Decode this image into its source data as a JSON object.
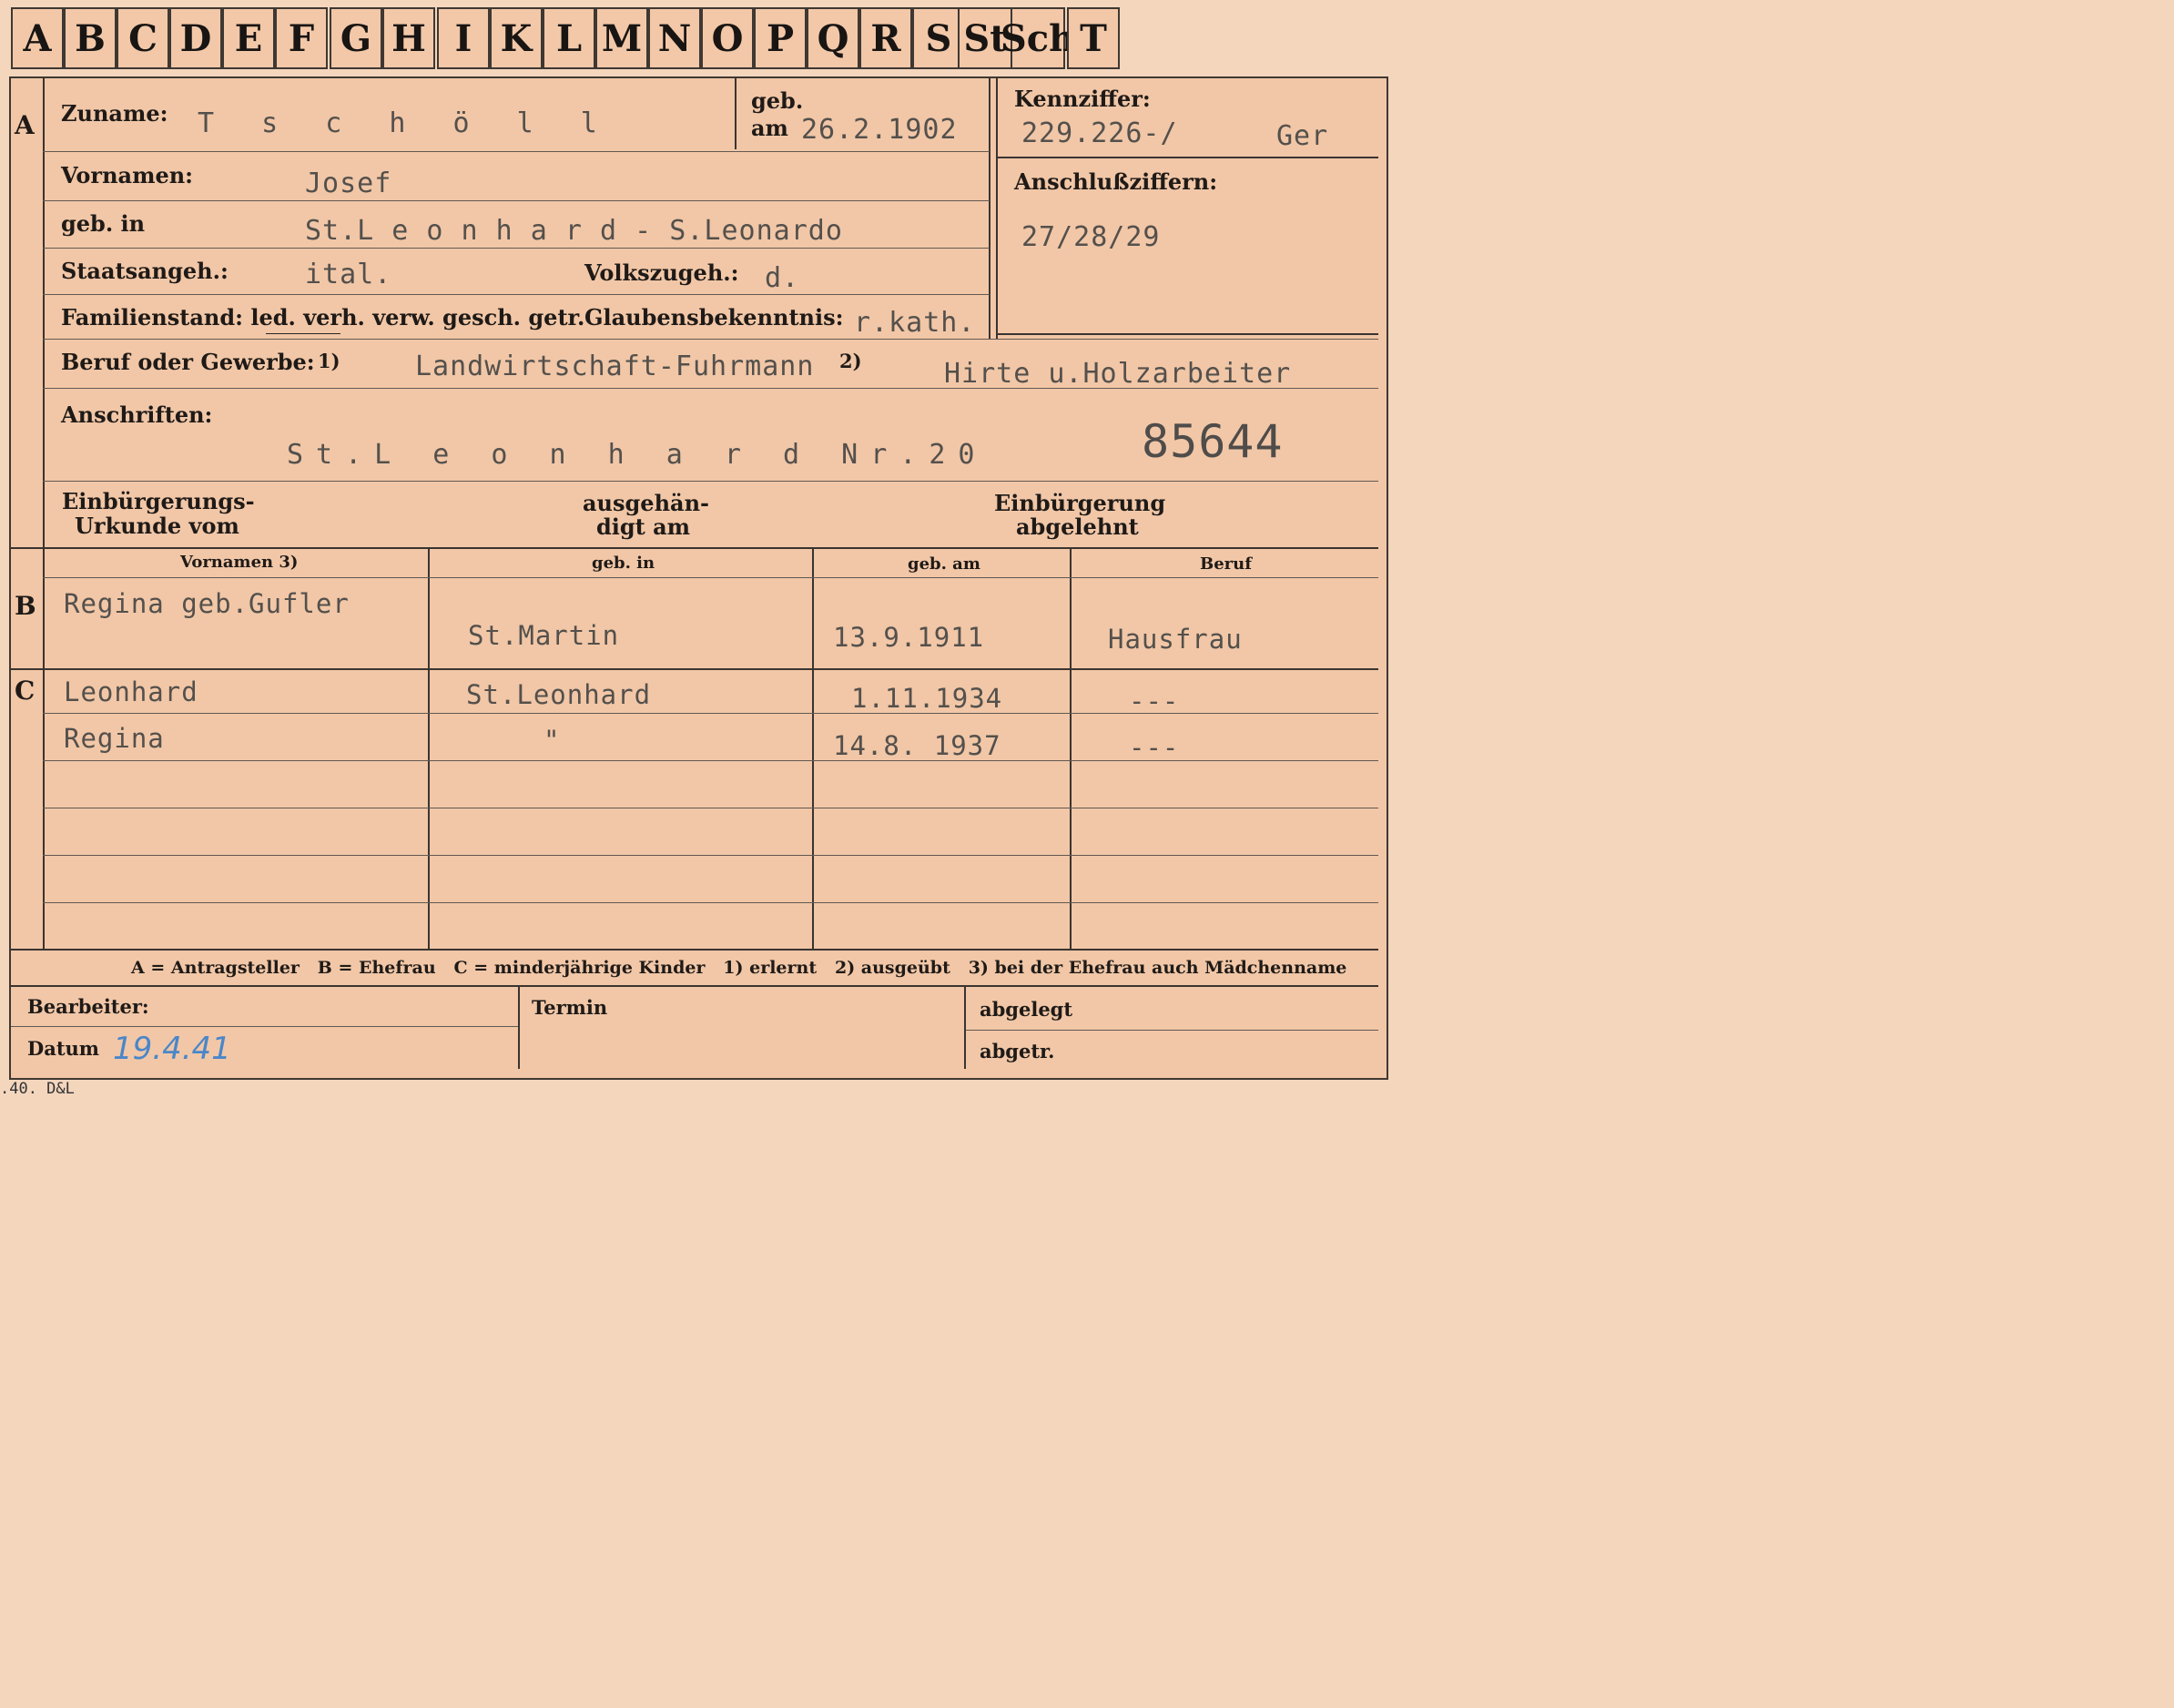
{
  "index_tabs": [
    "A",
    "B",
    "C",
    "D",
    "E",
    "F",
    "G",
    "H",
    "I",
    "K",
    "L",
    "M",
    "N",
    "O",
    "P",
    "Q",
    "R",
    "S",
    "St",
    "Sch",
    "T"
  ],
  "section_labels": {
    "a": "A",
    "b": "B",
    "c": "C"
  },
  "section_a": {
    "surname_label": "Zuname:",
    "surname_value": "T s c h ö l l",
    "born_label_1": "geb.",
    "born_label_2": "am",
    "born_value": "26.2.1902",
    "id_label": "Kennziffer:",
    "id_value": "229.226-/",
    "id_suffix": "Ger",
    "connect_label": "Anschlußziffern:",
    "connect_value": "27/28/29",
    "given_label": "Vornamen:",
    "given_value": "Josef",
    "birthplace_label": "geb. in",
    "birthplace_value": "St.L e o n h a r d  - S.Leonardo",
    "citizenship_label": "Staatsangeh.:",
    "citizenship_value": "ital.",
    "ethnicity_label": "Volkszugeh.:",
    "ethnicity_value": "d.",
    "marital_label": "Familienstand: led. verh. verw. gesch. getr.",
    "religion_label": "Glaubensbekenntnis:",
    "religion_value": "r.kath.",
    "profession_label": "Beruf oder Gewerbe:",
    "profession_note_1": "1)",
    "profession_value": "Landwirtschaft-Fuhrmann",
    "profession_note_2": "2)",
    "profession_value_2": "Hirte u.Holzarbeiter",
    "address_label": "Anschriften:",
    "address_value": "St.L e o n h a r d  Nr.20",
    "stamp_number": "85644",
    "naturalization_doc_label_1": "Einbürgerungs-",
    "naturalization_doc_label_2": "Urkunde vom",
    "handed_label_1": "ausgehän-",
    "handed_label_2": "digt am",
    "refused_label_1": "Einbürgerung",
    "refused_label_2": "abgelehnt"
  },
  "table_headers": {
    "given": "Vornamen 3)",
    "birthplace": "geb. in",
    "birthdate": "geb. am",
    "profession": "Beruf"
  },
  "spouse": {
    "given": "Regina geb.Gufler",
    "birthplace": "St.Martin",
    "birthdate": "13.9.1911",
    "profession": "Hausfrau"
  },
  "children": [
    {
      "given": "Leonhard",
      "birthplace": "St.Leonhard",
      "birthdate": "1.11.1934",
      "profession": "---"
    },
    {
      "given": "Regina",
      "birthplace": "\"",
      "birthdate": "14.8. 1937",
      "profession": "---"
    }
  ],
  "legend": "A = Antragsteller   B = Ehefrau   C = minderjährige Kinder   1) erlernt   2) ausgeübt   3) bei der Ehefrau auch Mädchenname",
  "footer": {
    "clerk_label": "Bearbeiter:",
    "date_label": "Datum",
    "date_value": "19.4.41",
    "deadline_label": "Termin",
    "filed_label": "abgelegt",
    "removed_label": "abgetr.",
    "print_mark": ".40. D&L"
  }
}
